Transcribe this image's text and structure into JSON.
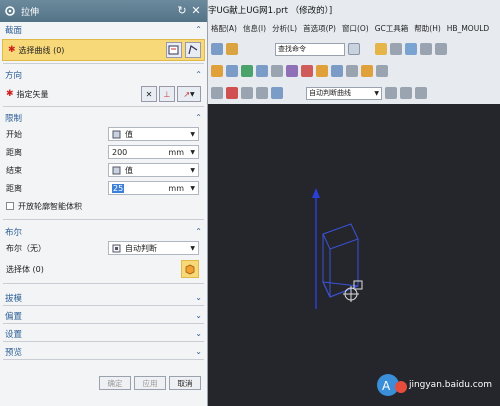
{
  "dialog": {
    "title": "拉伸",
    "sections": {
      "section": {
        "title": "截面",
        "select_curve": "选择曲线 (0)"
      },
      "direction": {
        "title": "方向",
        "specify_vector": "指定矢量"
      },
      "limits": {
        "title": "限制",
        "start_label": "开始",
        "start_value": "值",
        "start_dist_label": "距离",
        "start_dist_value": "200",
        "end_label": "结束",
        "end_value": "值",
        "end_dist_label": "距离",
        "end_dist_value": "25",
        "unit": "mm",
        "open_profile": "开放轮廓智能体积"
      },
      "boolean": {
        "title": "布尔",
        "bool_label": "布尔（无）",
        "bool_value": "自动判断",
        "select_body": "选择体 (0)"
      },
      "draft": {
        "title": "拔模"
      },
      "offset": {
        "title": "偏置"
      },
      "settings": {
        "title": "设置"
      },
      "preview": {
        "title": "预览"
      }
    },
    "buttons": {
      "ok": "确定",
      "apply": "应用",
      "cancel": "取消"
    }
  },
  "app": {
    "title": "字UG献上UG网1.prt （修改的）]",
    "menu": [
      "格配(A)",
      "信息(I)",
      "分析(L)",
      "首选项(P)",
      "窗口(O)",
      "GC工具箱",
      "帮助(H)",
      "HB_MOULD"
    ],
    "search_placeholder": "查找命令",
    "snap_combo": "自动判断曲线"
  },
  "watermark": "jingyan.baidu.com"
}
